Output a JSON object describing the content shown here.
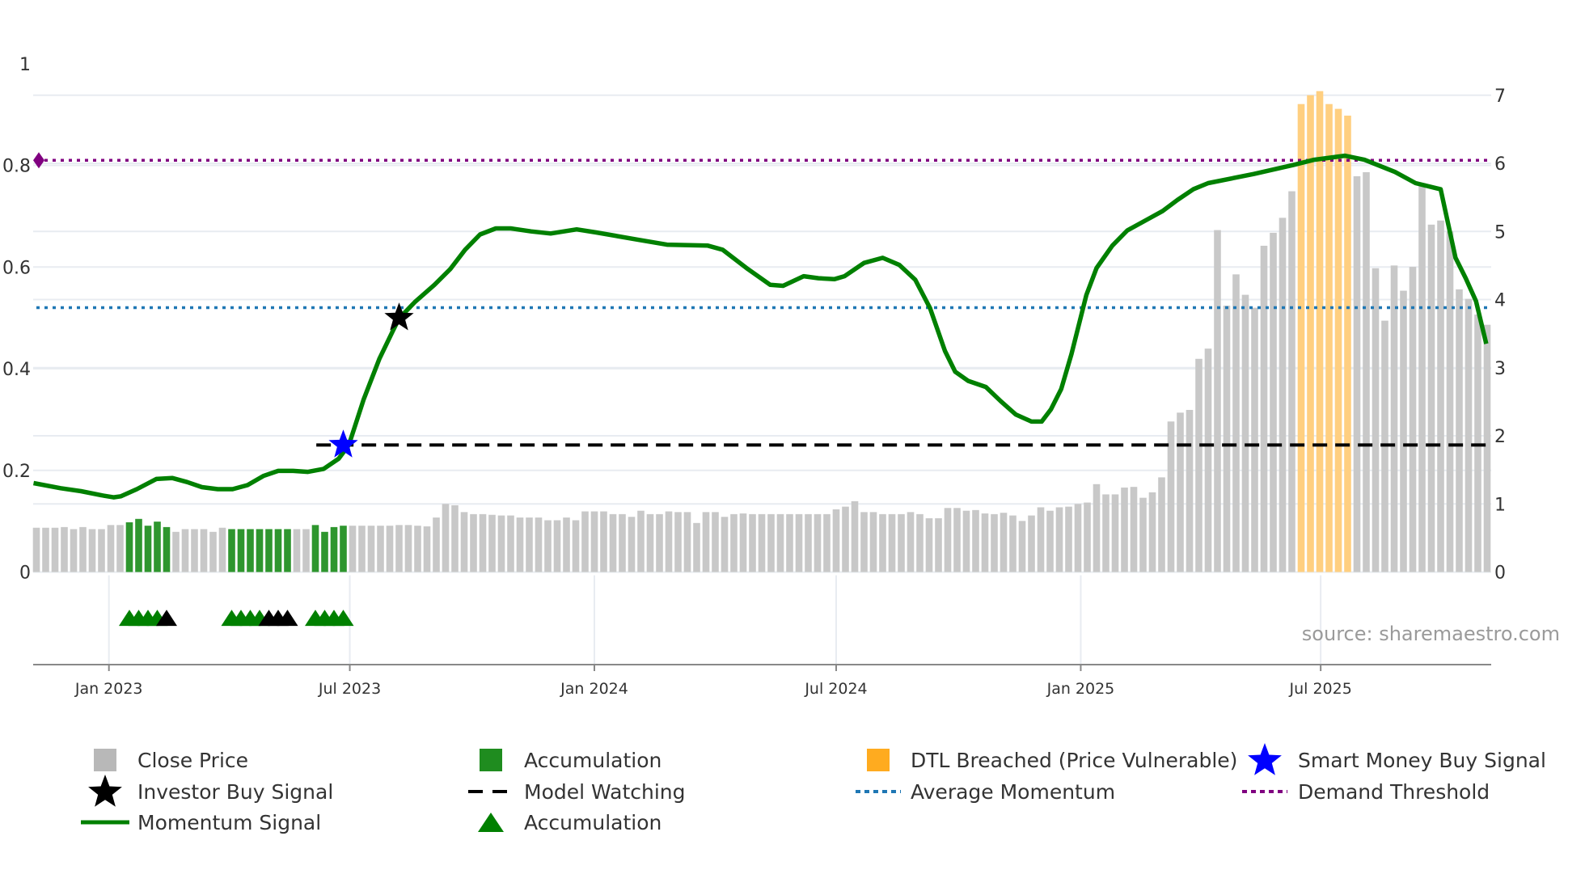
{
  "chart_data": {
    "type": "bar",
    "title": "",
    "xlabel": "",
    "ylabel_left": "",
    "ylabel_right": "",
    "x_unit": "week index (weekly bars, week 0 ≈ early Nov 2022)",
    "x_range": [
      -0.4,
      156.4
    ],
    "x_ticks": [
      {
        "label": "Jan 2023",
        "week": 7.8
      },
      {
        "label": "Jul 2023",
        "week": 33.7
      },
      {
        "label": "Jan 2024",
        "week": 60.0
      },
      {
        "label": "Jul 2024",
        "week": 86.0
      },
      {
        "label": "Jan 2025",
        "week": 112.3
      },
      {
        "label": "Jul 2025",
        "week": 138.1
      }
    ],
    "y_left": {
      "range": [
        -0.18,
        1.03
      ],
      "ticks": [
        "0",
        "0.2",
        "0.4",
        "0.6",
        "0.8",
        "1"
      ],
      "tick_values": [
        0,
        0.2,
        0.4,
        0.6,
        0.8,
        1
      ]
    },
    "y_right": {
      "range": [
        -1.36,
        7.7
      ],
      "ticks": [
        "0",
        "1",
        "2",
        "3",
        "4",
        "5",
        "6",
        "7"
      ],
      "tick_values": [
        0,
        1,
        2,
        3,
        4,
        5,
        6,
        7
      ]
    },
    "grid": true,
    "legend_placement": "bottom",
    "close_price": [
      0.65,
      0.65,
      0.65,
      0.66,
      0.63,
      0.66,
      0.63,
      0.63,
      0.69,
      0.69,
      0.73,
      0.78,
      0.68,
      0.74,
      0.66,
      0.59,
      0.63,
      0.63,
      0.63,
      0.59,
      0.65,
      0.63,
      0.63,
      0.63,
      0.63,
      0.63,
      0.63,
      0.63,
      0.63,
      0.63,
      0.69,
      0.59,
      0.66,
      0.68,
      0.68,
      0.68,
      0.68,
      0.68,
      0.68,
      0.69,
      0.69,
      0.68,
      0.67,
      0.8,
      1.0,
      0.98,
      0.88,
      0.85,
      0.85,
      0.84,
      0.83,
      0.83,
      0.8,
      0.8,
      0.8,
      0.76,
      0.76,
      0.8,
      0.76,
      0.89,
      0.89,
      0.89,
      0.85,
      0.85,
      0.81,
      0.9,
      0.85,
      0.85,
      0.89,
      0.88,
      0.88,
      0.72,
      0.88,
      0.88,
      0.81,
      0.85,
      0.86,
      0.85,
      0.85,
      0.85,
      0.85,
      0.85,
      0.85,
      0.85,
      0.85,
      0.85,
      0.92,
      0.96,
      1.04,
      0.88,
      0.88,
      0.85,
      0.85,
      0.85,
      0.88,
      0.85,
      0.79,
      0.79,
      0.94,
      0.94,
      0.9,
      0.91,
      0.86,
      0.85,
      0.87,
      0.83,
      0.75,
      0.83,
      0.95,
      0.9,
      0.95,
      0.96,
      1.0,
      1.02,
      1.29,
      1.14,
      1.14,
      1.24,
      1.25,
      1.09,
      1.17,
      1.39,
      2.21,
      2.34,
      2.38,
      3.13,
      3.28,
      5.02,
      3.91,
      4.37,
      4.07,
      3.88,
      4.79,
      4.98,
      5.2,
      5.59,
      6.87,
      7.0,
      7.06,
      6.87,
      6.8,
      6.7,
      5.81,
      5.87,
      4.46,
      3.69,
      4.5,
      4.13,
      4.48,
      5.71,
      5.1,
      5.16,
      5.0,
      4.15,
      4.01,
      3.78,
      3.63
    ],
    "accumulation_bar_weeks": [
      10,
      11,
      12,
      13,
      14,
      21,
      22,
      23,
      24,
      25,
      26,
      27,
      30,
      31,
      32,
      33
    ],
    "dtl_breached_bar_weeks": [
      136,
      137,
      138,
      139,
      140,
      141
    ],
    "momentum_signal": [
      [
        -0.3,
        0.175
      ],
      [
        2.6,
        0.165
      ],
      [
        4.8,
        0.159
      ],
      [
        7.0,
        0.151
      ],
      [
        8.3,
        0.147
      ],
      [
        9.1,
        0.149
      ],
      [
        10.8,
        0.163
      ],
      [
        12.9,
        0.183
      ],
      [
        14.6,
        0.185
      ],
      [
        16.2,
        0.177
      ],
      [
        17.8,
        0.167
      ],
      [
        19.5,
        0.163
      ],
      [
        21.1,
        0.163
      ],
      [
        22.7,
        0.171
      ],
      [
        24.4,
        0.189
      ],
      [
        26.0,
        0.199
      ],
      [
        27.6,
        0.199
      ],
      [
        29.2,
        0.197
      ],
      [
        30.9,
        0.203
      ],
      [
        32.5,
        0.223
      ],
      [
        33.6,
        0.25
      ],
      [
        35.2,
        0.34
      ],
      [
        36.9,
        0.42
      ],
      [
        38.3,
        0.473
      ],
      [
        39.0,
        0.499
      ],
      [
        40.7,
        0.531
      ],
      [
        42.8,
        0.565
      ],
      [
        44.5,
        0.596
      ],
      [
        46.1,
        0.634
      ],
      [
        47.7,
        0.664
      ],
      [
        49.4,
        0.676
      ],
      [
        51.0,
        0.676
      ],
      [
        53.2,
        0.67
      ],
      [
        55.3,
        0.666
      ],
      [
        58.1,
        0.674
      ],
      [
        60.2,
        0.668
      ],
      [
        64.6,
        0.654
      ],
      [
        67.8,
        0.644
      ],
      [
        72.2,
        0.642
      ],
      [
        73.8,
        0.634
      ],
      [
        76.5,
        0.596
      ],
      [
        78.9,
        0.565
      ],
      [
        80.3,
        0.563
      ],
      [
        82.5,
        0.582
      ],
      [
        84.1,
        0.578
      ],
      [
        85.8,
        0.576
      ],
      [
        86.9,
        0.582
      ],
      [
        89.0,
        0.608
      ],
      [
        91.0,
        0.618
      ],
      [
        92.8,
        0.604
      ],
      [
        94.5,
        0.575
      ],
      [
        96.1,
        0.519
      ],
      [
        97.7,
        0.435
      ],
      [
        98.8,
        0.394
      ],
      [
        100.2,
        0.376
      ],
      [
        102.1,
        0.364
      ],
      [
        103.7,
        0.336
      ],
      [
        105.3,
        0.31
      ],
      [
        107.0,
        0.296
      ],
      [
        108.1,
        0.296
      ],
      [
        109.1,
        0.32
      ],
      [
        110.2,
        0.36
      ],
      [
        111.3,
        0.429
      ],
      [
        112.9,
        0.545
      ],
      [
        114.0,
        0.598
      ],
      [
        115.7,
        0.642
      ],
      [
        117.3,
        0.672
      ],
      [
        119.5,
        0.694
      ],
      [
        121.1,
        0.71
      ],
      [
        122.7,
        0.732
      ],
      [
        124.4,
        0.753
      ],
      [
        126.0,
        0.765
      ],
      [
        130.9,
        0.783
      ],
      [
        135.2,
        0.801
      ],
      [
        137.4,
        0.811
      ],
      [
        140.7,
        0.819
      ],
      [
        142.8,
        0.811
      ],
      [
        146.1,
        0.787
      ],
      [
        148.3,
        0.765
      ],
      [
        151.0,
        0.753
      ],
      [
        152.6,
        0.618
      ],
      [
        153.7,
        0.578
      ],
      [
        154.8,
        0.533
      ],
      [
        155.9,
        0.449
      ]
    ],
    "average_momentum": 0.52,
    "demand_threshold": 0.81,
    "model_watching": {
      "value": 0.25,
      "from_week": 30.1,
      "to_week": 155.9
    },
    "smart_money_buy_signal": [
      {
        "week": 33.0,
        "value": 0.25
      }
    ],
    "investor_buy_signal": [
      {
        "week": 39.0,
        "value": 0.5
      }
    ],
    "accumulation_markers": {
      "value": -0.09,
      "green_weeks": [
        10,
        11,
        12,
        13,
        21,
        22,
        23,
        24,
        30,
        31,
        32,
        33
      ],
      "black_weeks": [
        14,
        25,
        26,
        27
      ]
    },
    "colors": {
      "close_price": "#c8c8c8",
      "close_price_legend": "#b8b8b8",
      "accumulation": "#2e962e",
      "accumulation_legend": "#1f8c1f",
      "dtl": "#ffcf80",
      "dtl_legend": "#ffab1f",
      "momentum": "#008000",
      "average": "#1f77b4",
      "demand": "#800080",
      "model_watching": "#000000",
      "smart_money": "#0000ff",
      "investor": "#000000",
      "grid": "#e8ecf1",
      "axis": "#888888"
    },
    "legend": [
      {
        "key": "close_price",
        "label": "Close Price",
        "symbol": "square-gray"
      },
      {
        "key": "accumulation_bar",
        "label": "Accumulation",
        "symbol": "square-green"
      },
      {
        "key": "dtl",
        "label": "DTL Breached (Price Vulnerable)",
        "symbol": "square-orange"
      },
      {
        "key": "smart_money",
        "label": "Smart Money Buy Signal",
        "symbol": "star-blue"
      },
      {
        "key": "investor",
        "label": "Investor Buy Signal",
        "symbol": "star-black"
      },
      {
        "key": "model_watching",
        "label": "Model Watching",
        "symbol": "dash-black"
      },
      {
        "key": "average",
        "label": "Average Momentum",
        "symbol": "dot-blue"
      },
      {
        "key": "demand",
        "label": "Demand Threshold",
        "symbol": "dot-purple"
      },
      {
        "key": "momentum",
        "label": "Momentum Signal",
        "symbol": "line-green"
      },
      {
        "key": "accumulation_marker",
        "label": "Accumulation",
        "symbol": "triangle-green"
      }
    ],
    "watermark": "source: sharemaestro.com"
  }
}
